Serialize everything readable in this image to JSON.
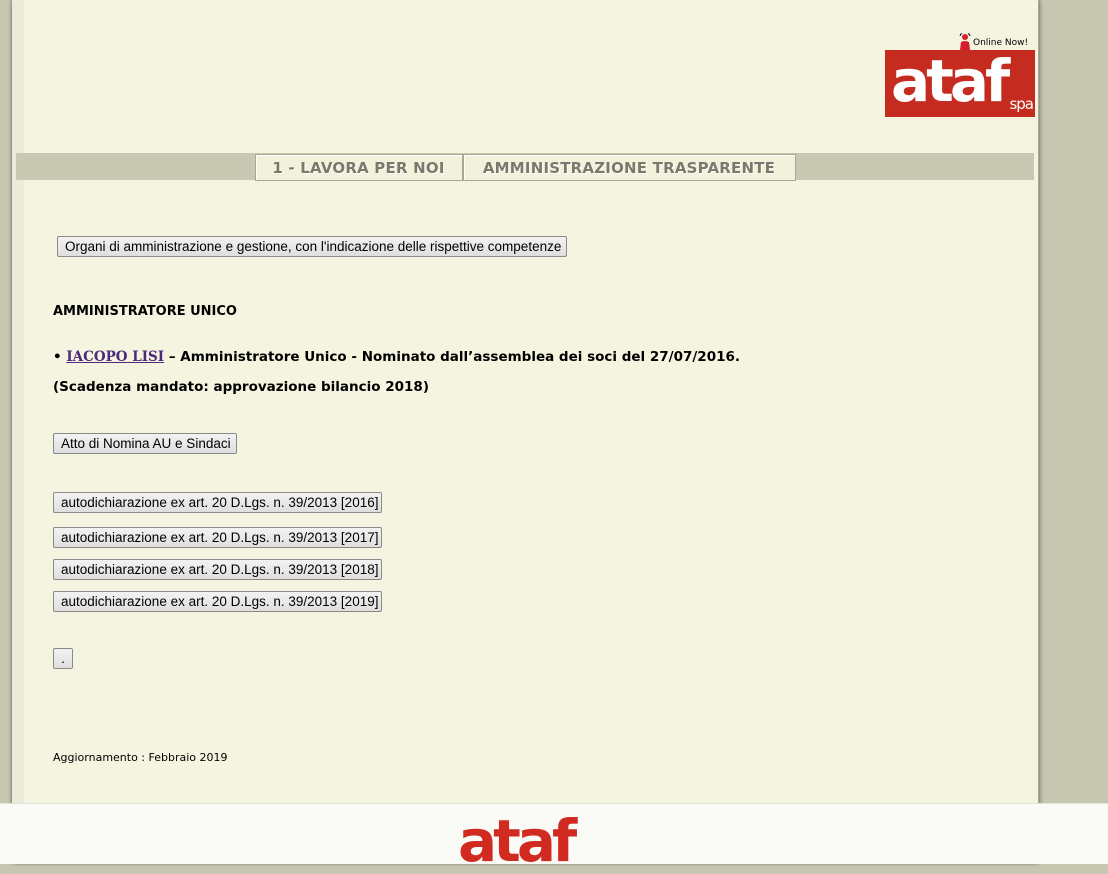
{
  "header": {
    "online_now": "Online Now!",
    "logo_text": "ataf",
    "logo_suffix": "spa"
  },
  "nav": {
    "tabs": [
      {
        "label": "1 - LAVORA PER NOI"
      },
      {
        "label": "AMMINISTRAZIONE TRASPARENTE"
      }
    ]
  },
  "main": {
    "organi_button": "Organi di amministrazione e gestione, con l'indicazione delle rispettive competenze",
    "section_heading": "AMMINISTRATORE UNICO",
    "bullet": "•",
    "admin_name": "IACOPO LISI",
    "admin_description": " – Amministratore Unico - Nominato dall’assemblea dei soci del 27/07/2016.",
    "mandate": "(Scadenza mandato: approvazione bilancio 2018)",
    "atto_button": "Atto di Nomina AU e Sindaci",
    "autodichiarazioni": [
      "autodichiarazione ex art. 20 D.Lgs. n. 39/2013 [2016]",
      "autodichiarazione ex art. 20 D.Lgs. n. 39/2013 [2017]",
      "autodichiarazione ex art. 20 D.Lgs. n. 39/2013 [2018]",
      "autodichiarazione ex art. 20 D.Lgs. n. 39/2013 [2019]"
    ],
    "dot_button": ".",
    "updated": "Aggiornamento : Febbraio 2019"
  },
  "footer": {
    "logo_text": "ataf"
  },
  "colors": {
    "logo_bg": "#c62b1f",
    "page_bg": "#f5f4e0",
    "outer_bg": "#c7c6b1",
    "link": "#4b2a7a"
  }
}
